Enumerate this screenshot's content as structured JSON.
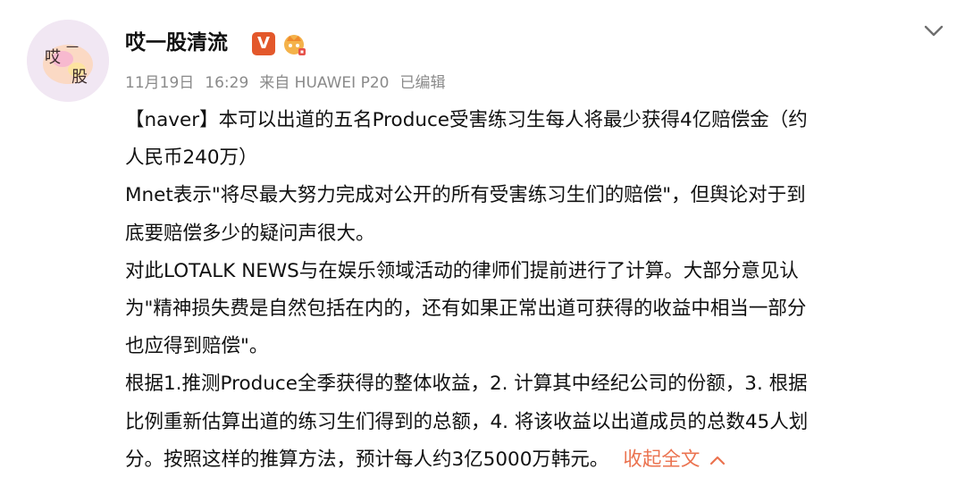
{
  "author": {
    "name": "哎一股清流",
    "avatar_text": [
      "哎",
      "一",
      "股"
    ],
    "verified_badge": "V"
  },
  "meta": {
    "date": "11月19日",
    "time": "16:29",
    "source": "来自 HUAWEI P20",
    "edited": "已编辑"
  },
  "content": {
    "lines": [
      "【naver】本可以出道的五名Produce受害练习生每人将最少获得4亿赔偿金（约",
      "人民币240万）",
      "Mnet表示\"将尽最大努力完成对公开的所有受害练习生们的赔偿\"，但舆论对于到",
      "底要赔偿多少的疑问声很大。",
      "对此LOTALK NEWS与在娱乐领域活动的律师们提前进行了计算。大部分意见认",
      "为\"精神损失费是自然包括在内的，还有如果正常出道可获得的收益中相当一部分",
      "也应得到赔偿\"。",
      "根据1.推测Produce全季获得的整体收益，2. 计算其中经纪公司的份额，3. 根据",
      "比例重新估算出道的练习生们得到的总额，4. 将该收益以出道成员的总数45人划",
      "分。按照这样的推算方法，预计每人约3亿5000万韩元。"
    ],
    "collapse_label": "收起全文"
  },
  "icons": {
    "menu": "chevron-down-icon",
    "collapse": "chevron-up-icon",
    "vip": "crown-icon"
  },
  "colors": {
    "accent": "#eb7350",
    "verified": "#e3582b",
    "meta_text": "#8a8a8a",
    "avatar_bg": "#f1e7f3"
  }
}
